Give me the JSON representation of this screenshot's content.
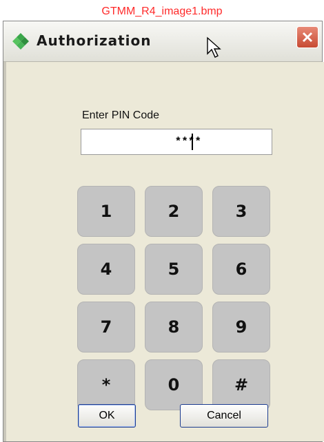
{
  "caption": "GTMM_R4_image1.bmp",
  "window": {
    "title": "Authorization",
    "icon": "diamond-logo-icon",
    "close_icon": "close-icon"
  },
  "pin": {
    "label": "Enter PIN Code",
    "value": "****"
  },
  "keypad": {
    "keys": [
      "1",
      "2",
      "3",
      "4",
      "5",
      "6",
      "7",
      "8",
      "9",
      "*",
      "0",
      "#"
    ]
  },
  "buttons": {
    "ok": "OK",
    "cancel": "Cancel"
  },
  "colors": {
    "caption": "#ff2a2a",
    "window_bg": "#ece9d8",
    "key_bg": "#c4c4c4",
    "close_bg": "#c74a33"
  }
}
